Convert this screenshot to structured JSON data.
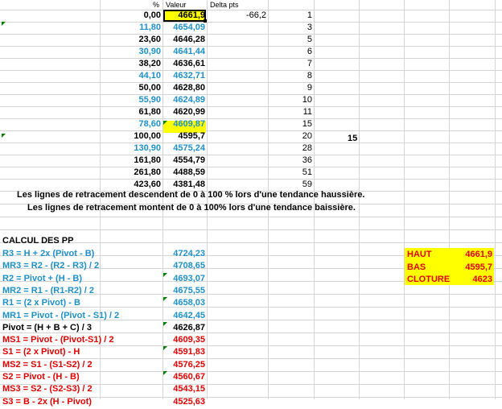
{
  "header": {
    "pct_label": "%",
    "valeur_label": "Valeur",
    "delta_label": "Delta pts"
  },
  "delta_value": "-66,2",
  "side_value": "15",
  "rows": [
    {
      "pct": "0,00",
      "val": "4661,9",
      "idx": "1",
      "color": "#000000"
    },
    {
      "pct": "11,80",
      "val": "4654,09",
      "idx": "3",
      "color": "#1e90c8"
    },
    {
      "pct": "23,60",
      "val": "4646,28",
      "idx": "5",
      "color": "#000000"
    },
    {
      "pct": "30,90",
      "val": "4641,44",
      "idx": "6",
      "color": "#1e90c8"
    },
    {
      "pct": "38,20",
      "val": "4636,61",
      "idx": "7",
      "color": "#000000"
    },
    {
      "pct": "44,10",
      "val": "4632,71",
      "idx": "8",
      "color": "#1e90c8"
    },
    {
      "pct": "50,00",
      "val": "4628,80",
      "idx": "9",
      "color": "#000000"
    },
    {
      "pct": "55,90",
      "val": "4624,89",
      "idx": "10",
      "color": "#1e90c8"
    },
    {
      "pct": "61,80",
      "val": "4620,99",
      "idx": "11",
      "color": "#000000"
    },
    {
      "pct": "78,60",
      "val": "4609,87",
      "idx": "15",
      "color": "#1e90c8"
    },
    {
      "pct": "100,00",
      "val": "4595,7",
      "idx": "20",
      "color": "#000000"
    },
    {
      "pct": "130,90",
      "val": "4575,24",
      "idx": "28",
      "color": "#1e90c8"
    },
    {
      "pct": "161,80",
      "val": "4554,79",
      "idx": "36",
      "color": "#000000"
    },
    {
      "pct": "261,80",
      "val": "4488,59",
      "idx": "51",
      "color": "#000000"
    },
    {
      "pct": "423,60",
      "val": "4381,48",
      "idx": "59",
      "color": "#000000"
    }
  ],
  "notes": [
    "Les lignes de retracement descendent de 0 à 100 % lors d'une tendance haussière.",
    "Les lignes de retracement montent de 0 à 100% lors d'une tendance baissière."
  ],
  "pp": {
    "title": "CALCUL DES PP",
    "rows": [
      {
        "label": "R3 = H + 2x (Pivot - B)",
        "val": "4724,23",
        "color": "#1e90c8"
      },
      {
        "label": "MR3 = R2 - (R2 - R3) / 2",
        "val": "4708,65",
        "color": "#1e90c8"
      },
      {
        "label": "R2 = Pivot + (H - B)",
        "val": "4693,07",
        "color": "#1e90c8"
      },
      {
        "label": "MR2 = R1 - (R1-R2) / 2",
        "val": "4675,55",
        "color": "#1e90c8"
      },
      {
        "label": "R1 = (2 x Pivot) - B",
        "val": "4658,03",
        "color": "#1e90c8"
      },
      {
        "label": "MR1 = Pivot - (Pivot - S1) / 2",
        "val": "4642,45",
        "color": "#1e90c8"
      },
      {
        "label": "Pivot = (H + B + C) / 3",
        "val": "4626,87",
        "color": "#000000"
      },
      {
        "label": "MS1 = Pivot - (Pivot-S1) / 2",
        "val": "4609,35",
        "color": "#e00000"
      },
      {
        "label": "S1 = (2 x Pivot) - H",
        "val": "4591,83",
        "color": "#e00000"
      },
      {
        "label": "MS2 = S1 - (S1-S2) / 2",
        "val": "4576,25",
        "color": "#e00000"
      },
      {
        "label": "S2 = Pivot - (H - B)",
        "val": "4560,67",
        "color": "#e00000"
      },
      {
        "label": "MS3 = S2 - (S2-S3) / 2",
        "val": "4543,15",
        "color": "#e00000"
      },
      {
        "label": "S3 = B - 2x (H - Pivot)",
        "val": "4525,63",
        "color": "#e00000"
      }
    ]
  },
  "hbc": [
    {
      "label": "HAUT",
      "val": "4661,9"
    },
    {
      "label": "BAS",
      "val": "4595,7"
    },
    {
      "label": "CLOTURE",
      "val": "4623"
    }
  ],
  "colors": {
    "highlight": "#ffff00",
    "blue": "#1e90c8",
    "red": "#e00000",
    "grid": "#d4d4d4",
    "comment-marker": "#008000"
  }
}
